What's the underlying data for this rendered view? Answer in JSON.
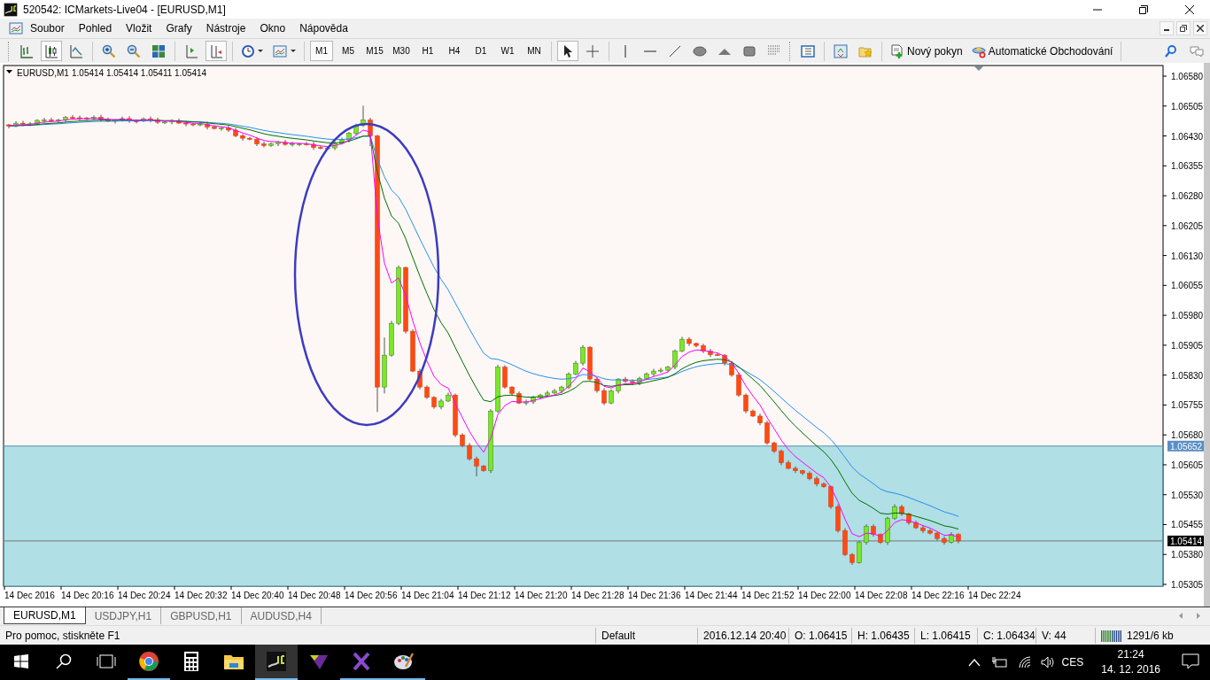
{
  "window": {
    "title": "520542: ICMarkets-Live04 - [EURUSD,M1]"
  },
  "menu": [
    "Soubor",
    "Pohled",
    "Vložit",
    "Grafy",
    "Nástroje",
    "Okno",
    "Nápověda"
  ],
  "toolbar": {
    "chart_types": [
      {
        "selected": false
      },
      {
        "selected": true
      },
      {
        "selected": false
      }
    ],
    "auto_scroll": true,
    "timeframes": [
      {
        "label": "M1",
        "selected": true
      },
      {
        "label": "M5",
        "selected": false
      },
      {
        "label": "M15",
        "selected": false
      },
      {
        "label": "M30",
        "selected": false
      },
      {
        "label": "H1",
        "selected": false
      },
      {
        "label": "H4",
        "selected": false
      },
      {
        "label": "D1",
        "selected": false
      },
      {
        "label": "W1",
        "selected": false
      },
      {
        "label": "MN",
        "selected": false
      }
    ],
    "cursor_modes": [
      {
        "selected": true
      },
      {
        "selected": false
      }
    ],
    "new_order": "Nový pokyn",
    "auto_trading": "Automatické Obchodování"
  },
  "chart": {
    "symbol": "EURUSD,M1",
    "ohlc": "1.05414 1.05414 1.05411 1.05414",
    "y_ticks": [
      "1.06580",
      "1.06505",
      "1.06430",
      "1.06355",
      "1.06280",
      "1.06205",
      "1.06130",
      "1.06055",
      "1.05980",
      "1.05905",
      "1.05830",
      "1.05755",
      "1.05680",
      "1.05605",
      "1.05530",
      "1.05455",
      "1.05380",
      "1.05305"
    ],
    "zone_label": "1.05652",
    "price_label": "1.05414",
    "x_ticks": [
      "14 Dec 2016",
      "14 Dec 20:16",
      "14 Dec 20:24",
      "14 Dec 20:32",
      "14 Dec 20:40",
      "14 Dec 20:48",
      "14 Dec 20:56",
      "14 Dec 21:04",
      "14 Dec 21:12",
      "14 Dec 21:20",
      "14 Dec 21:28",
      "14 Dec 21:36",
      "14 Dec 21:44",
      "14 Dec 21:52",
      "14 Dec 22:00",
      "14 Dec 22:08",
      "14 Dec 22:16",
      "14 Dec 22:24"
    ]
  },
  "tabs": [
    {
      "label": "EURUSD,M1",
      "selected": true
    },
    {
      "label": "USDJPY,H1",
      "selected": false
    },
    {
      "label": "GBPUSD,H1",
      "selected": false
    },
    {
      "label": "AUDUSD,H4",
      "selected": false
    }
  ],
  "status_bar": {
    "help": "Pro pomoc, stiskněte F1",
    "profile": "Default",
    "time": "2016.12.14 20:40",
    "open": "O: 1.06415",
    "high": "H: 1.06435",
    "low": "L: 1.06415",
    "close": "C: 1.06434",
    "volume": "V: 44",
    "traffic": "1291/6 kb"
  },
  "taskbar": {
    "apps": [
      {
        "running": true,
        "active": false
      },
      {
        "running": false,
        "active": false
      },
      {
        "running": false,
        "active": false
      },
      {
        "running": true,
        "active": true
      },
      {
        "running": false,
        "active": false
      },
      {
        "running": true,
        "active": false
      },
      {
        "running": true,
        "active": false
      }
    ],
    "language": "CES",
    "time": "21:24",
    "date": "14. 12. 2016"
  }
}
